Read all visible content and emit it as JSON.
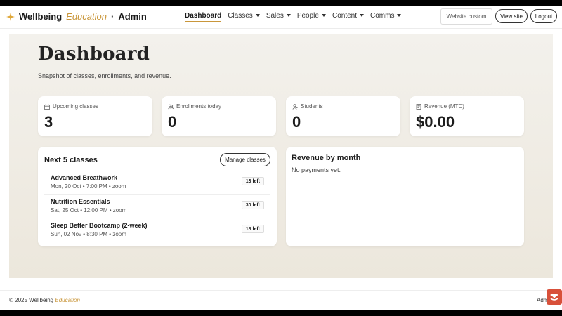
{
  "brand": {
    "name_start": "Wellbeing",
    "name_accent": "Education",
    "separator": "·",
    "name_end": "Admin",
    "accent_color": "#c9963a"
  },
  "nav": {
    "items": [
      {
        "label": "Dashboard",
        "active": true
      },
      {
        "label": "Classes",
        "dropdown": true
      },
      {
        "label": "Sales",
        "dropdown": true
      },
      {
        "label": "People",
        "dropdown": true
      },
      {
        "label": "Content",
        "dropdown": true
      },
      {
        "label": "Comms",
        "dropdown": true
      }
    ],
    "website_custom": "Website custom",
    "view_site": "View site",
    "logout": "Logout"
  },
  "page": {
    "title": "Dashboard",
    "subtitle": "Snapshot of classes, enrollments, and revenue."
  },
  "stats": [
    {
      "label": "Upcoming classes",
      "value": "3",
      "icon": "calendar-icon"
    },
    {
      "label": "Enrollments today",
      "value": "0",
      "icon": "users-icon"
    },
    {
      "label": "Students",
      "value": "0",
      "icon": "user-icon"
    },
    {
      "label": "Revenue (MTD)",
      "value": "$0.00",
      "icon": "receipt-icon"
    }
  ],
  "classes": {
    "heading": "Next 5 classes",
    "manage_label": "Manage classes",
    "items": [
      {
        "title": "Advanced Breathwork",
        "meta": "Mon, 20 Oct • 7:00 PM • zoom",
        "seats": "13 left"
      },
      {
        "title": "Nutrition Essentials",
        "meta": "Sat, 25 Oct • 12:00 PM • zoom",
        "seats": "30 left"
      },
      {
        "title": "Sleep Better Bootcamp (2-week)",
        "meta": "Sun, 02 Nov • 8:30 PM • zoom",
        "seats": "18 left"
      }
    ]
  },
  "revenue": {
    "heading": "Revenue by month",
    "empty": "No payments yet."
  },
  "footer": {
    "copy_start": "© 2025 Wellbeing",
    "copy_accent": "Education",
    "right": "Adm"
  }
}
